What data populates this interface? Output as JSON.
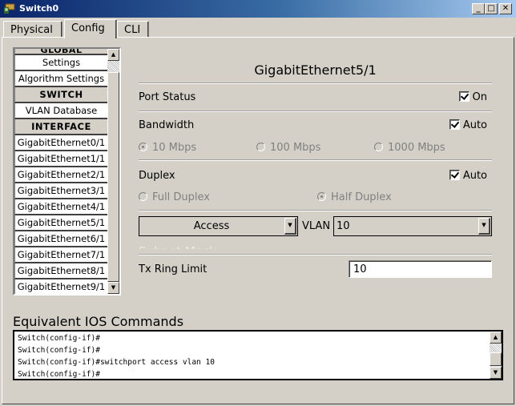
{
  "window": {
    "title": "Switch0",
    "icon": "switch-app-icon",
    "controls": {
      "minimize": "_",
      "maximize": "□",
      "close": "✕"
    }
  },
  "tabs": [
    {
      "label": "Physical",
      "active": false
    },
    {
      "label": "Config",
      "active": true
    },
    {
      "label": "CLI",
      "active": false
    }
  ],
  "sidebar": {
    "items": [
      {
        "label": "GLOBAL",
        "type": "header"
      },
      {
        "label": "Settings",
        "type": "item"
      },
      {
        "label": "Algorithm Settings",
        "type": "item"
      },
      {
        "label": "SWITCH",
        "type": "header"
      },
      {
        "label": "VLAN Database",
        "type": "item"
      },
      {
        "label": "INTERFACE",
        "type": "header"
      },
      {
        "label": "GigabitEthernet0/1",
        "type": "item"
      },
      {
        "label": "GigabitEthernet1/1",
        "type": "item"
      },
      {
        "label": "GigabitEthernet2/1",
        "type": "item"
      },
      {
        "label": "GigabitEthernet3/1",
        "type": "item"
      },
      {
        "label": "GigabitEthernet4/1",
        "type": "item"
      },
      {
        "label": "GigabitEthernet5/1",
        "type": "item"
      },
      {
        "label": "GigabitEthernet6/1",
        "type": "item"
      },
      {
        "label": "GigabitEthernet7/1",
        "type": "item"
      },
      {
        "label": "GigabitEthernet8/1",
        "type": "item"
      },
      {
        "label": "GigabitEthernet9/1",
        "type": "item"
      }
    ],
    "scroll_up": "▲",
    "scroll_down": "▼"
  },
  "interface": {
    "title": "GigabitEthernet5/1",
    "port_status": {
      "label": "Port Status",
      "checkbox_label": "On",
      "checked": true
    },
    "bandwidth": {
      "label": "Bandwidth",
      "auto_label": "Auto",
      "auto_checked": true,
      "options": [
        {
          "label": "10 Mbps",
          "selected": true
        },
        {
          "label": "100 Mbps",
          "selected": false
        },
        {
          "label": "1000 Mbps",
          "selected": false
        }
      ]
    },
    "duplex": {
      "label": "Duplex",
      "auto_label": "Auto",
      "auto_checked": true,
      "options": [
        {
          "label": "Full Duplex",
          "selected": false
        },
        {
          "label": "Half Duplex",
          "selected": true
        }
      ]
    },
    "mode_select": {
      "value": "Access"
    },
    "vlan": {
      "label": "VLAN",
      "value": "10"
    },
    "hidden_label": "Subnet Mask",
    "tx_ring_limit": {
      "label": "Tx Ring Limit",
      "value": "10"
    },
    "dropdown_arrow": "▼"
  },
  "ios": {
    "title": "Equivalent IOS Commands",
    "lines": [
      "Switch(config-if)#",
      "Switch(config-if)#",
      "Switch(config-if)#switchport access vlan 10",
      "Switch(config-if)#"
    ],
    "scroll_up": "▲",
    "scroll_down": "▼"
  }
}
